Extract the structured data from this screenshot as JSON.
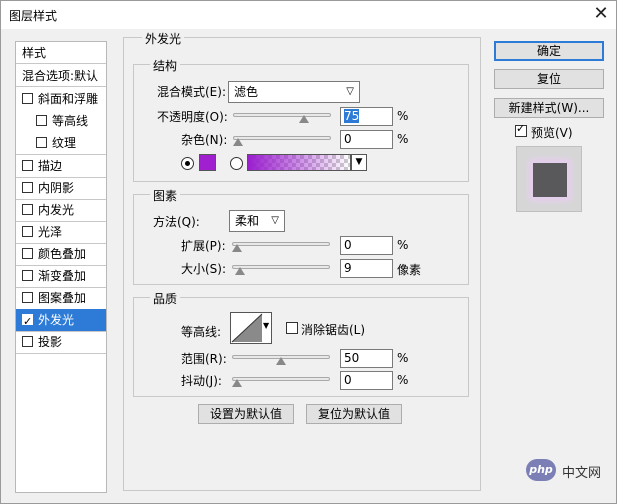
{
  "window": {
    "title": "图层样式",
    "close": "✕"
  },
  "left_list": {
    "header": "样式",
    "blend_options": "混合选项:默认",
    "items": [
      {
        "label": "斜面和浮雕",
        "checked": false
      },
      {
        "label": "等高线",
        "checked": false,
        "sub": true
      },
      {
        "label": "纹理",
        "checked": false,
        "sub": true
      },
      {
        "label": "描边",
        "checked": false
      },
      {
        "label": "内阴影",
        "checked": false
      },
      {
        "label": "内发光",
        "checked": false
      },
      {
        "label": "光泽",
        "checked": false
      },
      {
        "label": "颜色叠加",
        "checked": false
      },
      {
        "label": "渐变叠加",
        "checked": false
      },
      {
        "label": "图案叠加",
        "checked": false
      },
      {
        "label": "外发光",
        "checked": true,
        "selected": true
      },
      {
        "label": "投影",
        "checked": false
      }
    ]
  },
  "panel": {
    "title": "外发光",
    "structure": {
      "legend": "结构",
      "blend_mode_label": "混合模式(E):",
      "blend_mode_value": "滤色",
      "opacity_label": "不透明度(O):",
      "opacity_value": "75",
      "opacity_unit": "%",
      "noise_label": "杂色(N):",
      "noise_value": "0",
      "noise_unit": "%",
      "solid_color": "#a020d0",
      "gradient_from": "#9b1fcf",
      "levels": {
        "opacity": 0.75,
        "noise": 0
      }
    },
    "elements": {
      "legend": "图素",
      "method_label": "方法(Q):",
      "method_value": "柔和",
      "spread_label": "扩展(P):",
      "spread_value": "0",
      "spread_unit": "%",
      "size_label": "大小(S):",
      "size_value": "9",
      "size_unit": "像素",
      "levels": {
        "spread": 0,
        "size": 0.036
      }
    },
    "quality": {
      "legend": "品质",
      "contour_label": "等高线:",
      "antialias_label": "消除锯齿(L)",
      "antialias_checked": false,
      "range_label": "范围(R):",
      "range_value": "50",
      "range_unit": "%",
      "jitter_label": "抖动(J):",
      "jitter_value": "0",
      "jitter_unit": "%",
      "levels": {
        "range": 0.5,
        "jitter": 0
      }
    },
    "set_default": "设置为默认值",
    "reset_default": "复位为默认值"
  },
  "buttons": {
    "ok": "确定",
    "reset": "复位",
    "new_style": "新建样式(W)...",
    "preview_label": "预览(V)",
    "preview_checked": true
  },
  "watermark": {
    "logo": "php",
    "text": "中文网"
  },
  "icons": {
    "dropdown": "chevron-down-icon",
    "slider": "slider-thumb-icon",
    "contour": "contour-curve-icon"
  }
}
